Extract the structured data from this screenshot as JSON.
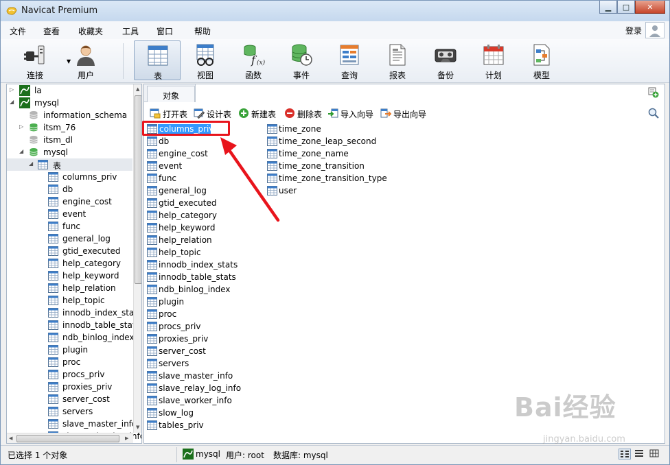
{
  "window": {
    "title": "Navicat Premium"
  },
  "window_controls": {
    "minimize": "▁",
    "maximize": "□",
    "close": "✕"
  },
  "menu": {
    "items": [
      "文件",
      "查看",
      "收藏夹",
      "工具",
      "窗口",
      "帮助"
    ],
    "login": "登录"
  },
  "toolbar": {
    "buttons": [
      {
        "label": "连接",
        "icon": "plug-icon"
      },
      {
        "label": "用户",
        "icon": "user-icon"
      },
      {
        "label": "表",
        "icon": "table-icon",
        "active": true
      },
      {
        "label": "视图",
        "icon": "view-glasses-icon"
      },
      {
        "label": "函数",
        "icon": "function-icon"
      },
      {
        "label": "事件",
        "icon": "event-clock-icon"
      },
      {
        "label": "查询",
        "icon": "query-icon"
      },
      {
        "label": "报表",
        "icon": "report-icon"
      },
      {
        "label": "备份",
        "icon": "backup-tape-icon"
      },
      {
        "label": "计划",
        "icon": "calendar-icon"
      },
      {
        "label": "模型",
        "icon": "model-icon"
      }
    ]
  },
  "sidebar": {
    "connections": [
      {
        "label": "la",
        "expanded": false
      },
      {
        "label": "mysql",
        "expanded": true
      }
    ],
    "databases": [
      {
        "label": "information_schema",
        "expandable": false
      },
      {
        "label": "itsm_76",
        "expandable": true
      },
      {
        "label": "itsm_dl",
        "expandable": false
      },
      {
        "label": "mysql",
        "expandable": true,
        "expanded": true
      }
    ],
    "tables_node": "表",
    "tables": [
      "columns_priv",
      "db",
      "engine_cost",
      "event",
      "func",
      "general_log",
      "gtid_executed",
      "help_category",
      "help_keyword",
      "help_relation",
      "help_topic",
      "innodb_index_stat",
      "innodb_table_stat",
      "ndb_binlog_index",
      "plugin",
      "proc",
      "procs_priv",
      "proxies_priv",
      "server_cost",
      "servers",
      "slave_master_info",
      "slave_relay_log_info"
    ]
  },
  "content": {
    "tab": "对象",
    "actions": [
      {
        "label": "打开表",
        "icon": "open-table-icon"
      },
      {
        "label": "设计表",
        "icon": "design-table-icon"
      },
      {
        "label": "新建表",
        "icon": "new-table-icon"
      },
      {
        "label": "删除表",
        "icon": "delete-table-icon"
      },
      {
        "label": "导入向导",
        "icon": "import-wizard-icon"
      },
      {
        "label": "导出向导",
        "icon": "export-wizard-icon"
      }
    ],
    "tables_col1": [
      "columns_priv",
      "db",
      "engine_cost",
      "event",
      "func",
      "general_log",
      "gtid_executed",
      "help_category",
      "help_keyword",
      "help_relation",
      "help_topic",
      "innodb_index_stats",
      "innodb_table_stats",
      "ndb_binlog_index",
      "plugin",
      "proc",
      "procs_priv",
      "proxies_priv",
      "server_cost",
      "servers",
      "slave_master_info",
      "slave_relay_log_info",
      "slave_worker_info",
      "slow_log",
      "tables_priv"
    ],
    "tables_col2": [
      "time_zone",
      "time_zone_leap_second",
      "time_zone_name",
      "time_zone_transition",
      "time_zone_transition_type",
      "user"
    ],
    "selected": "columns_priv"
  },
  "status": {
    "selection": "已选择 1 个对象",
    "connection": "mysql",
    "user": "用户: root",
    "database": "数据库: mysql"
  },
  "colors": {
    "selection": "#3399ff",
    "annotation": "#e8141c",
    "table_icon_header": "#3d7ec9"
  },
  "watermark": {
    "main": "Bai经验",
    "sub": "jingyan.baidu.com"
  }
}
